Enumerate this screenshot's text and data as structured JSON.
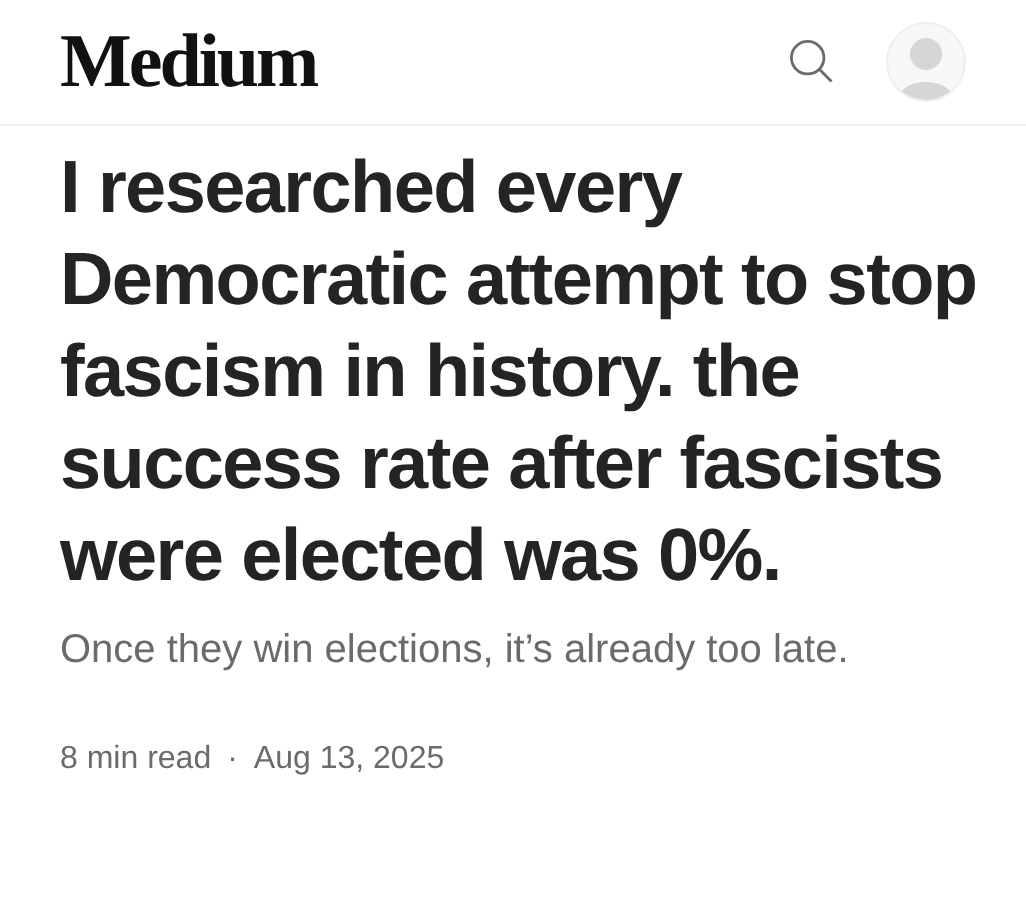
{
  "header": {
    "logo": "Medium"
  },
  "article": {
    "title": "I researched every Democratic attempt to stop fascism in history. the success rate after fascists were elected was 0%.",
    "subtitle": "Once they win elections, it’s already too late.",
    "read_time": "8 min read",
    "separator": "·",
    "date": "Aug 13, 2025"
  }
}
